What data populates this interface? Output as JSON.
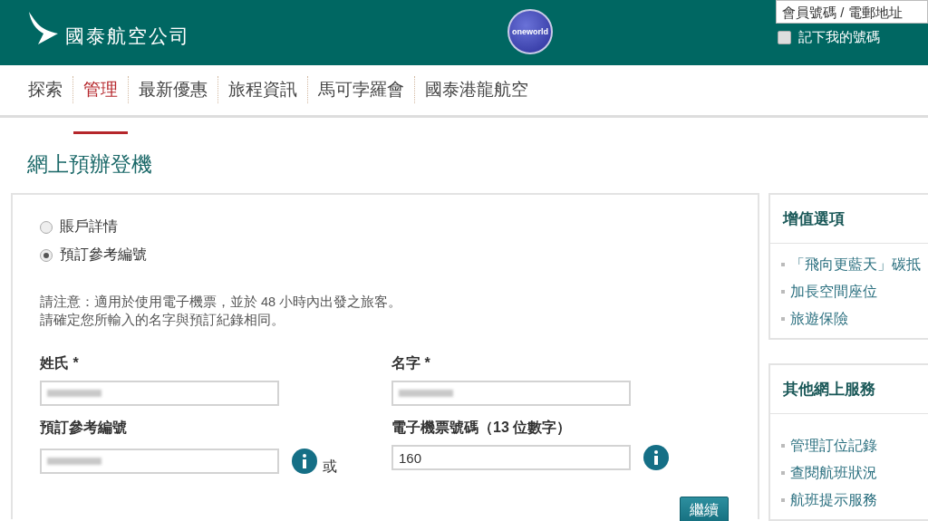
{
  "header": {
    "logo_text": "國泰航空公司",
    "alliance_logo_text": "oneworld",
    "member_field": {
      "placeholder": "會員號碼 / 電郵地址"
    },
    "remember": {
      "label": "記下我的號碼",
      "checked": false
    }
  },
  "nav": [
    {
      "label": "探索",
      "selected": false
    },
    {
      "label": "管理",
      "selected": true
    },
    {
      "label": "最新優惠",
      "selected": false
    },
    {
      "label": "旅程資訊",
      "selected": false
    },
    {
      "label": "馬可孛羅會",
      "selected": false
    },
    {
      "label": "國泰港龍航空",
      "selected": false
    }
  ],
  "page_title": "網上預辦登機",
  "lookup_options": [
    {
      "label": "賬戶詳情",
      "selected": false
    },
    {
      "label": "預訂參考編號",
      "selected": true
    }
  ],
  "notes": [
    "請注意：適用於使用電子機票，並於 48 小時內出發之旅客。",
    "請確定您所輸入的名字與預訂紀錄相同。"
  ],
  "fields": [
    {
      "label": "姓氏 *",
      "blurred": true,
      "info": false
    },
    {
      "label": "名字 *",
      "blurred": true,
      "info": false
    },
    {
      "label": "預訂參考編號",
      "blurred": true,
      "info": true,
      "suffix": "或"
    },
    {
      "label": "電子機票號碼（13 位數字）",
      "value": "160",
      "blurred": false,
      "info": true
    }
  ],
  "continue_button": "繼續",
  "sidebar": [
    {
      "title": "增值選項",
      "links": [
        "「飛向更藍天」碳抵",
        "加長空間座位",
        "旅遊保險"
      ]
    },
    {
      "title": "其他網上服務",
      "links": [
        "管理訂位記錄",
        "查閱航班狀況",
        "航班提示服務"
      ]
    }
  ]
}
